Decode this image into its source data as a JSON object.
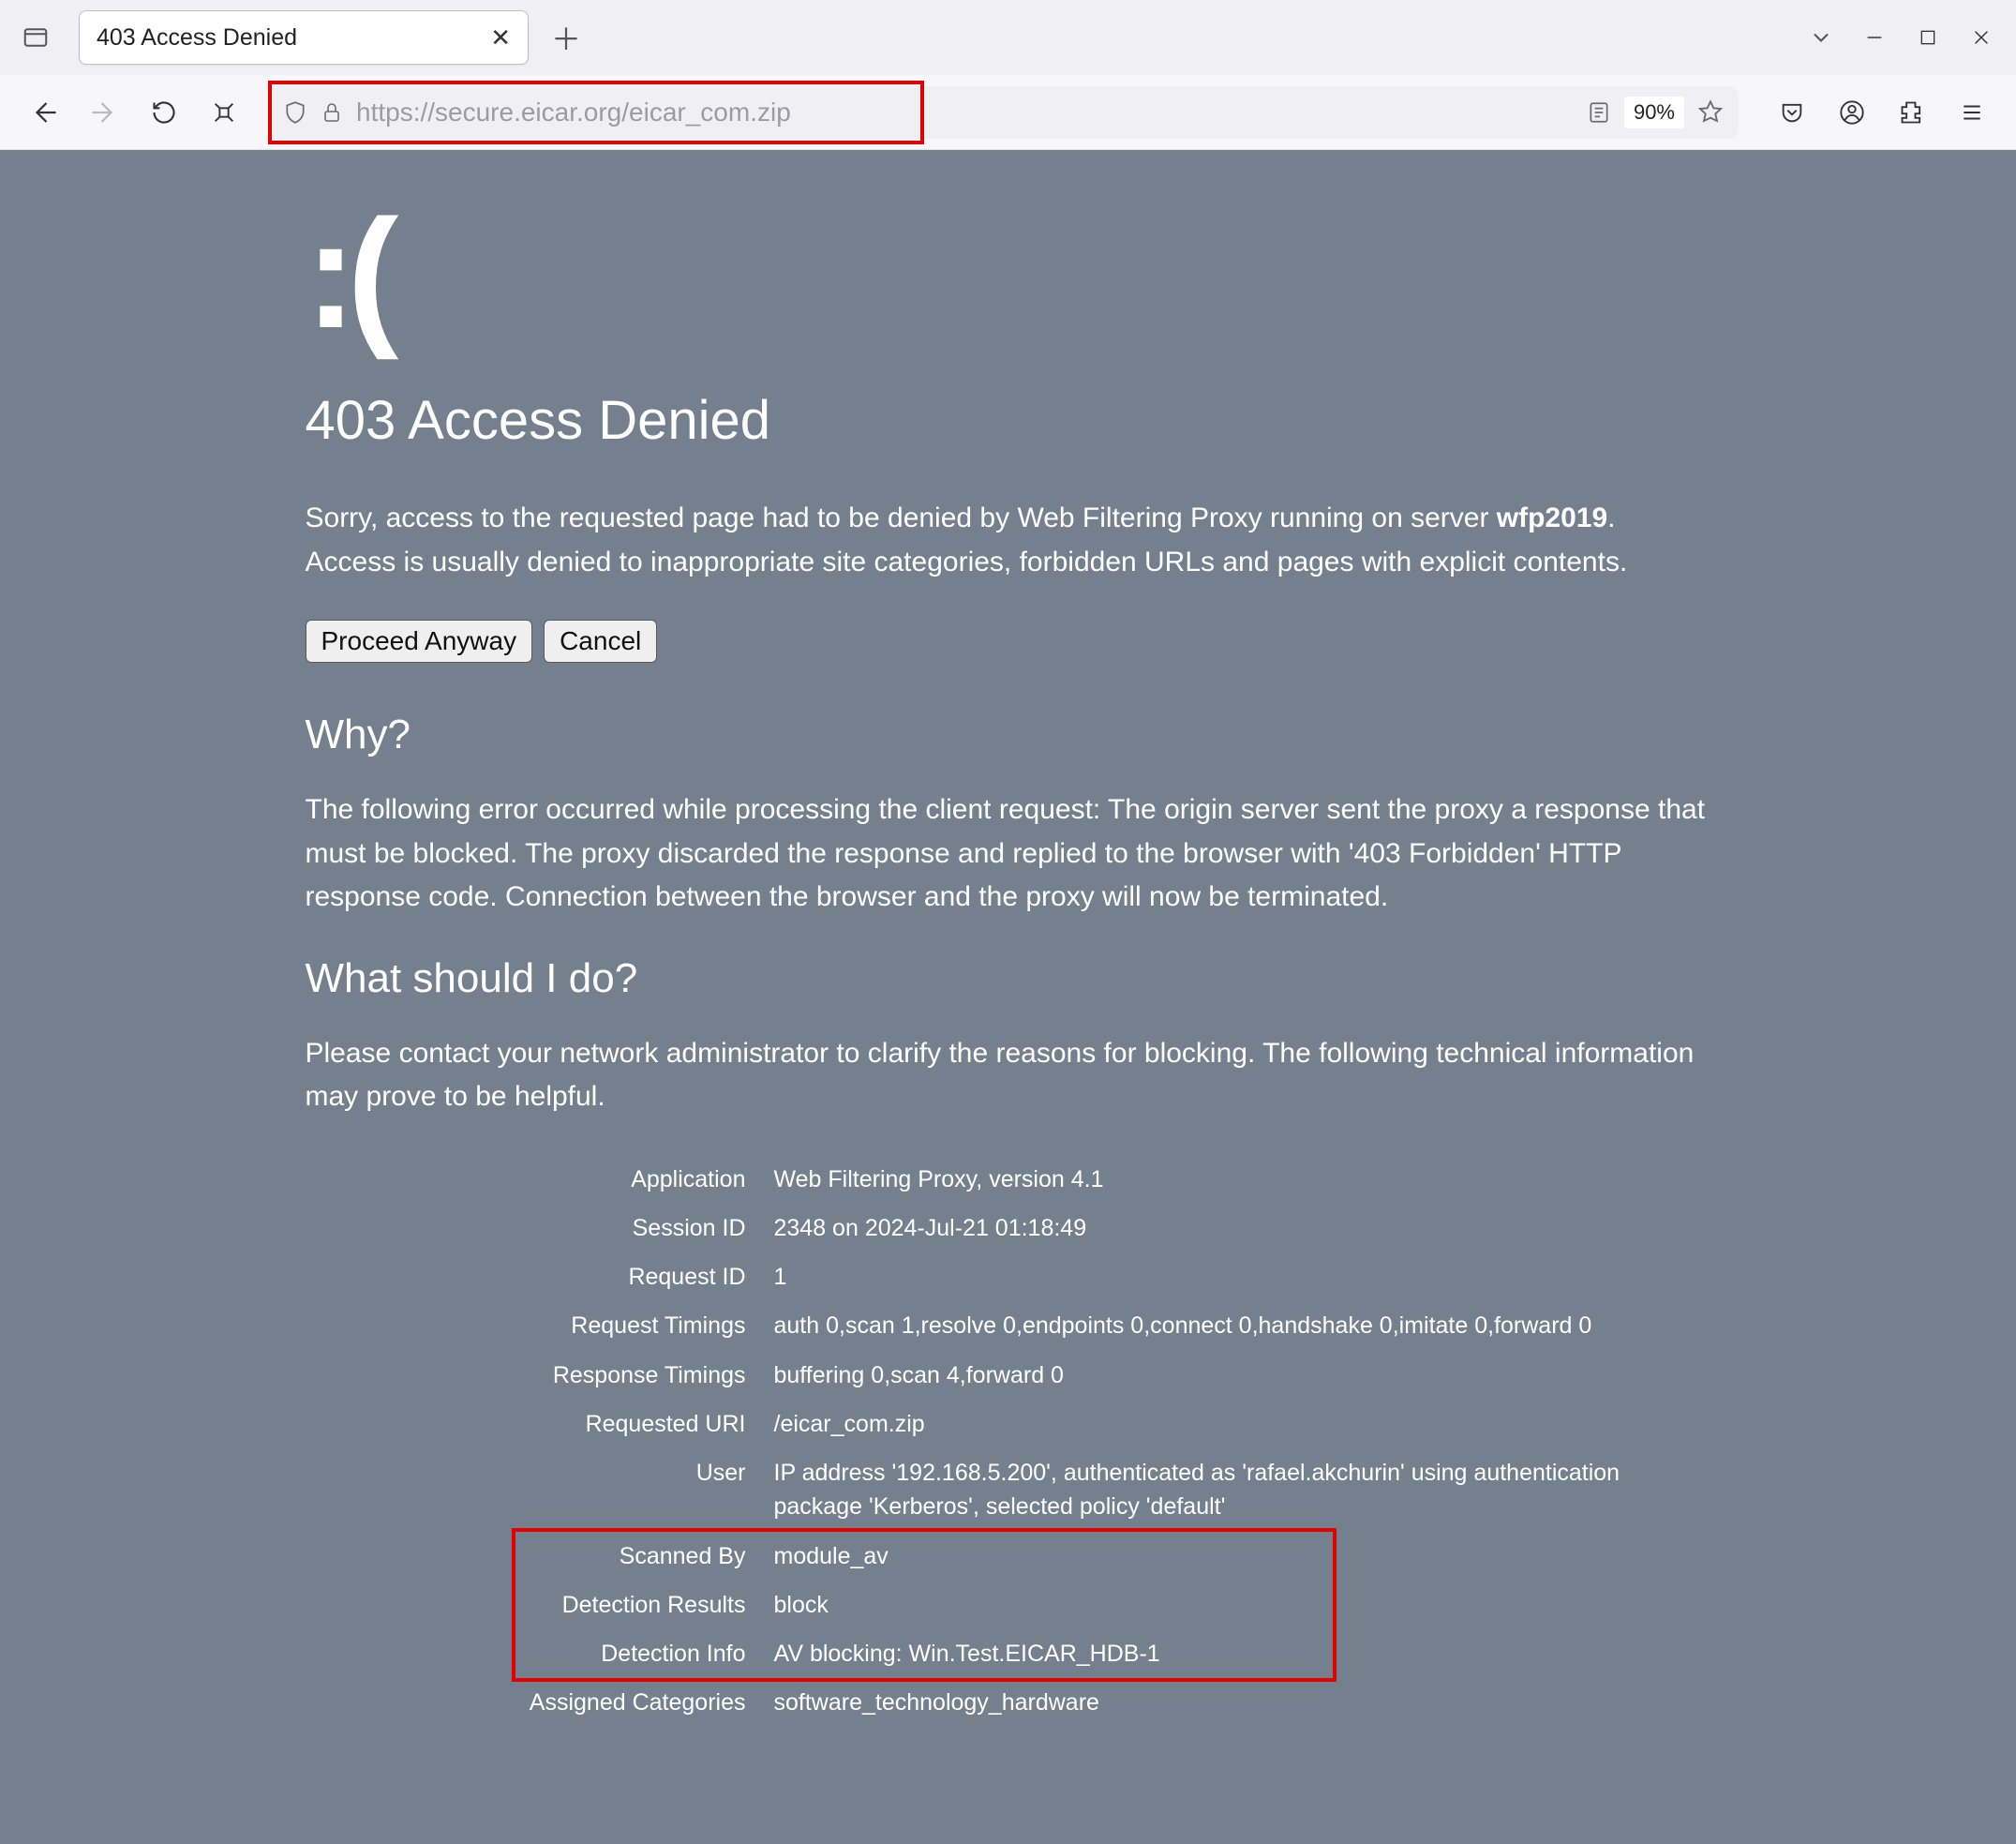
{
  "browser": {
    "tab_title": "403 Access Denied",
    "url": "https://secure.eicar.org/eicar_com.zip",
    "zoom": "90%"
  },
  "page": {
    "sad_face": ":(",
    "title": "403 Access Denied",
    "intro_before": "Sorry, access to the requested page had to be denied by Web Filtering Proxy running on server ",
    "server_name": "wfp2019",
    "intro_after": ". Access is usually denied to inappropriate site categories, forbidden URLs and pages with explicit contents.",
    "btn_proceed": "Proceed Anyway",
    "btn_cancel": "Cancel",
    "why_heading": "Why?",
    "why_text": "The following error occurred while processing the client request: The origin server sent the proxy a response that must be blocked. The proxy discarded the response and replied to the browser with '403 Forbidden' HTTP response code. Connection between the browser and the proxy will now be terminated.",
    "what_heading": "What should I do?",
    "what_text": "Please contact your network administrator to clarify the reasons for blocking. The following technical information may prove to be helpful.",
    "rows": [
      {
        "label": "Application",
        "value": "Web Filtering Proxy, version 4.1"
      },
      {
        "label": "Session ID",
        "value": "2348 on 2024-Jul-21 01:18:49"
      },
      {
        "label": "Request ID",
        "value": "1"
      },
      {
        "label": "Request Timings",
        "value": "auth 0,scan 1,resolve 0,endpoints 0,connect 0,handshake 0,imitate 0,forward 0"
      },
      {
        "label": "Response Timings",
        "value": "buffering 0,scan 4,forward 0"
      },
      {
        "label": "Requested URI",
        "value": "/eicar_com.zip"
      },
      {
        "label": "User",
        "value": "IP address '192.168.5.200', authenticated as 'rafael.akchurin' using authentication package 'Kerberos', selected policy 'default'"
      },
      {
        "label": "Scanned By",
        "value": "module_av"
      },
      {
        "label": "Detection Results",
        "value": "block"
      },
      {
        "label": "Detection Info",
        "value": "AV blocking: Win.Test.EICAR_HDB-1"
      },
      {
        "label": "Assigned Categories",
        "value": "software_technology_hardware"
      }
    ]
  }
}
